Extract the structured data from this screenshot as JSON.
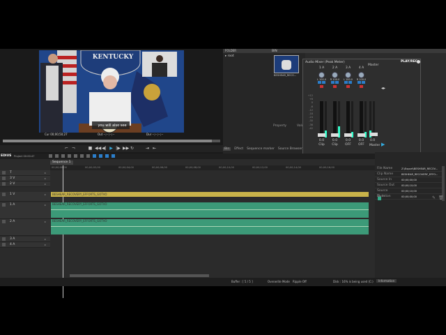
{
  "app": {
    "name": "EDIUS",
    "project": "Project 00:00:47"
  },
  "player": {
    "banner_text": "KENTUCKY",
    "caption_line": "you will also see",
    "cur_label": "Cur",
    "cur_tc": "00;00;50;27",
    "out_label": "Out",
    "out_tc": "--;--;--;--",
    "dur_label": "Dur",
    "dur_tc": "--;--;--;--"
  },
  "bin": {
    "header": "FOLDER",
    "root_label": "root",
    "clip_header": "BIN",
    "clip_name": "BESHEAR_RECO...",
    "property_label": "Property",
    "value_label": "Value",
    "tabs": [
      "Bin",
      "Effect",
      "Sequence marker",
      "Source Browser"
    ]
  },
  "mixer": {
    "title": "Audio Mixer (Peak Meter)",
    "play_rec": "PLAY/REC",
    "channels": [
      {
        "label": "1 A",
        "pan": "L 100.0",
        "gain": "0.0",
        "mode": "Clip",
        "level": 0.2
      },
      {
        "label": "2 A",
        "pan": "R 100.0",
        "gain": "0.0",
        "mode": "Clip",
        "level": 0.3
      },
      {
        "label": "3 A",
        "pan": "L 100.0",
        "gain": "0.0",
        "mode": "OFF",
        "level": 0.15
      },
      {
        "label": "4 A",
        "pan": "R 100.0",
        "gain": "0.0",
        "mode": "OFF",
        "level": 0.15
      }
    ],
    "master_label": "Master",
    "master_gain": "0.0",
    "master_mode": "Master",
    "scale": [
      "+12",
      "+6",
      "0",
      "-6",
      "-12",
      "-18",
      "-24",
      "-30",
      "-36",
      "-42"
    ]
  },
  "info": {
    "rows": [
      {
        "k": "File Name",
        "v": "Z:\\Export\\BESHEAR_RECOV..."
      },
      {
        "k": "Clip Name",
        "v": "BESHEAR_RECOVERY_EFFO..."
      },
      {
        "k": "Source In",
        "v": "00;00;00;00"
      },
      {
        "k": "Source Out",
        "v": "00;00;10;00"
      },
      {
        "k": "Source Duration",
        "v": "00;00;10;00"
      },
      {
        "k": "TL In",
        "v": "00;00;00;00"
      }
    ]
  },
  "timeline": {
    "sequence_tab": "Sequence 1",
    "ruler": [
      "00;00;00;00",
      "00;00;02;00",
      "00;00;04;00",
      "00;00;06;00",
      "00;00;08;00",
      "00;00;10;00",
      "00;00;12;00",
      "00;00;14;00",
      "00;00;16;00"
    ],
    "tracks": [
      {
        "label": "T"
      },
      {
        "label": "3 V"
      },
      {
        "label": "2 V"
      },
      {
        "label": "1 V"
      },
      {
        "label": "1 A"
      },
      {
        "label": "2 A"
      },
      {
        "label": "3 A"
      },
      {
        "label": "4 A"
      }
    ],
    "clip_title": "BESHEAR_RECOVERY_EFFORTS_GOTVO",
    "colors": {
      "video_clip": "#c9b34a",
      "audio_clip": "#3c9a78"
    }
  },
  "status": {
    "buffer": "Buffer : [ 5 / 5 ]",
    "overwrite": "Overwrite Mode",
    "ripple": "Ripple Off",
    "disk": "Disk : 16% is being used (C:)",
    "info_tab": "Information"
  }
}
